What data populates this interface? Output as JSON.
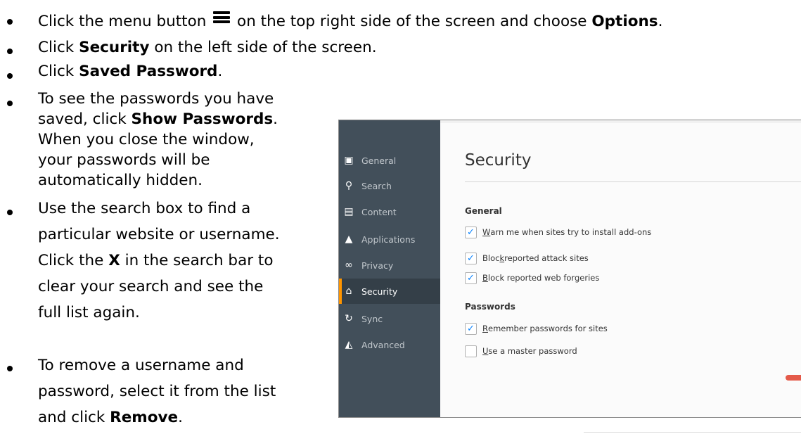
{
  "instructions": {
    "l1_pre": "Click the menu button",
    "l1_mid": "on the top right side of the screen and choose",
    "l1_bold": "Options",
    "l1_end": ".",
    "l2_pre": "Click",
    "l2_bold": "Security",
    "l2_post": "on the left side of the screen.",
    "l3_pre": "Click",
    "l3_bold": "Saved Password",
    "l3_end": ".",
    "l4_a": "To see the passwords you have",
    "l4_b_pre": "saved, click",
    "l4_b_bold": "Show Passwords",
    "l4_b_end": ".",
    "l4_c": "When you close the window,",
    "l4_d": "your passwords will be",
    "l4_e": "automatically hidden.",
    "l5_a": "Use the search box to find a",
    "l5_b": "particular website or username.",
    "l5_c_pre": "Click the",
    "l5_c_bold": "X",
    "l5_c_post": "in the search bar to",
    "l5_d": "clear your search and see the",
    "l5_e": "full list again.",
    "l6_a": "To remove a username and",
    "l6_b": "password, select it from the list",
    "l6_c_pre": "and click",
    "l6_c_bold": "Remove",
    "l6_c_end": "."
  },
  "settings": {
    "sidebar": {
      "items": [
        {
          "label": "General",
          "icon": "general-icon",
          "glyph": "▣"
        },
        {
          "label": "Search",
          "icon": "search-icon",
          "glyph": "⚲"
        },
        {
          "label": "Content",
          "icon": "content-icon",
          "glyph": "▤"
        },
        {
          "label": "Applications",
          "icon": "applications-icon",
          "glyph": "▲"
        },
        {
          "label": "Privacy",
          "icon": "privacy-icon",
          "glyph": "∞"
        },
        {
          "label": "Security",
          "icon": "security-icon",
          "glyph": "⌂"
        },
        {
          "label": "Sync",
          "icon": "sync-icon",
          "glyph": "↻"
        },
        {
          "label": "Advanced",
          "icon": "advanced-icon",
          "glyph": "◭"
        }
      ],
      "active": "Security"
    },
    "title": "Security",
    "general": {
      "heading": "General",
      "opt1_u": "W",
      "opt1_rest": "arn me when sites try to install add-ons",
      "opt1_checked": true,
      "opt2_pre": "Bloc",
      "opt2_u": "k",
      "opt2_rest": " reported attack sites",
      "opt2_checked": true,
      "opt3_u": "B",
      "opt3_rest": "lock reported web forgeries",
      "opt3_checked": true
    },
    "passwords": {
      "heading": "Passwords",
      "opt1_u": "R",
      "opt1_rest": "emember passwords for sites",
      "opt1_checked": true,
      "opt2_u": "U",
      "opt2_rest": "se a master password",
      "opt2_checked": false
    },
    "check_glyph": "✓",
    "colors": {
      "sidebar": "#424f5a",
      "active": "#343f48",
      "accent": "#ff9500",
      "check": "#0a84ff"
    }
  }
}
